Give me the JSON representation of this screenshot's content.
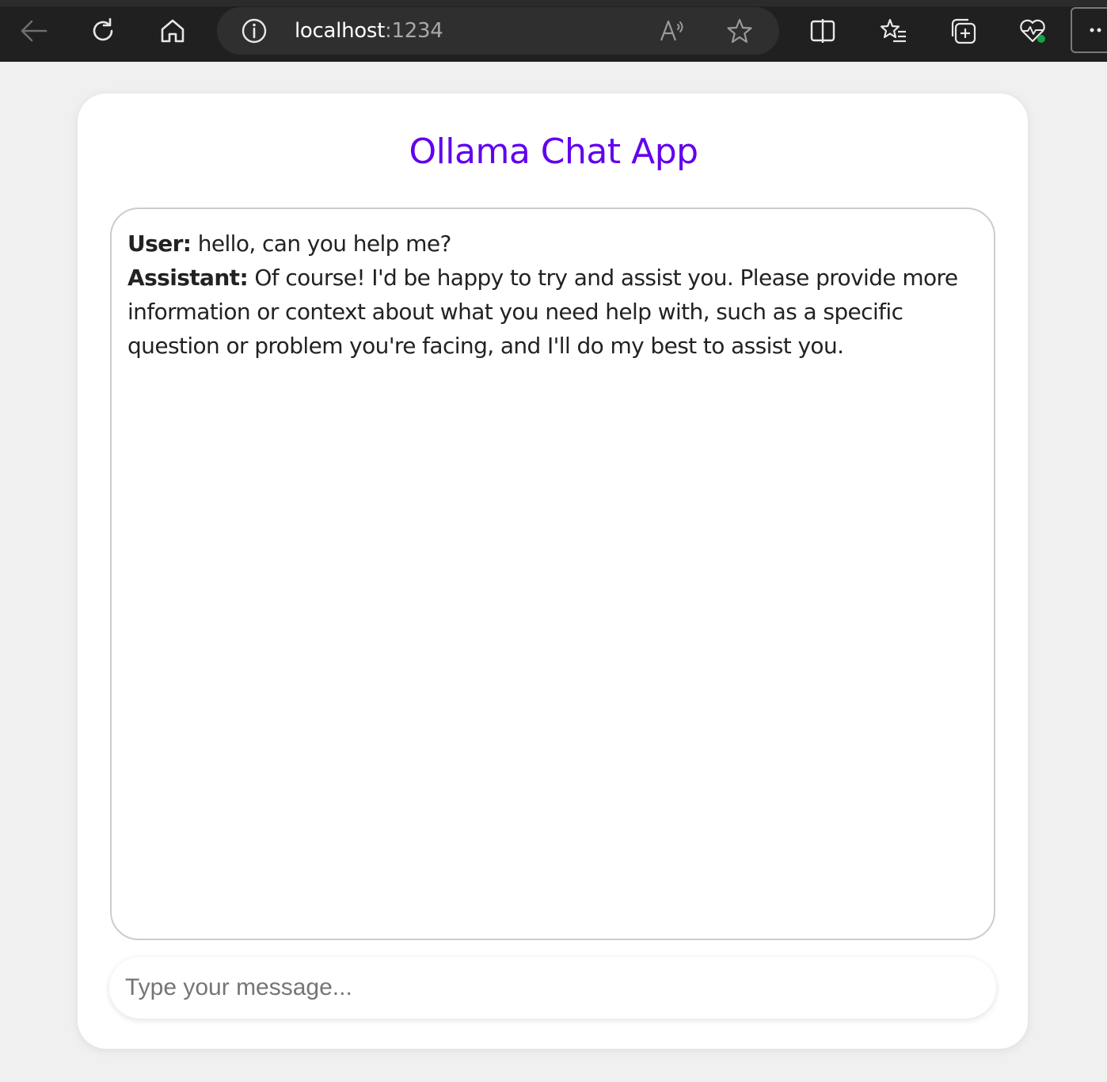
{
  "browser": {
    "address": {
      "host": "localhost",
      "port": ":1234"
    },
    "icons": {
      "back": "back-arrow-icon",
      "refresh": "refresh-icon",
      "home": "home-icon",
      "info": "site-info-icon",
      "read_aloud": "read-aloud-icon",
      "favorite": "favorite-star-icon",
      "split_screen": "split-screen-icon",
      "favorites": "favorites-list-icon",
      "collections": "collections-icon",
      "health": "browser-essentials-icon",
      "more": "more-options-icon"
    }
  },
  "app": {
    "title": "Ollama Chat App",
    "colors": {
      "title": "#6200ee",
      "page_background": "#f0f0f0",
      "card": "#ffffff"
    },
    "messages": [
      {
        "role": "User:",
        "text": " hello, can you help me?"
      },
      {
        "role": "Assistant:",
        "text": " Of course! I'd be happy to try and assist you. Please provide more information or context about what you need help with, such as a specific question or problem you're facing, and I'll do my best to assist you."
      }
    ],
    "input": {
      "placeholder": "Type your message...",
      "value": ""
    }
  }
}
